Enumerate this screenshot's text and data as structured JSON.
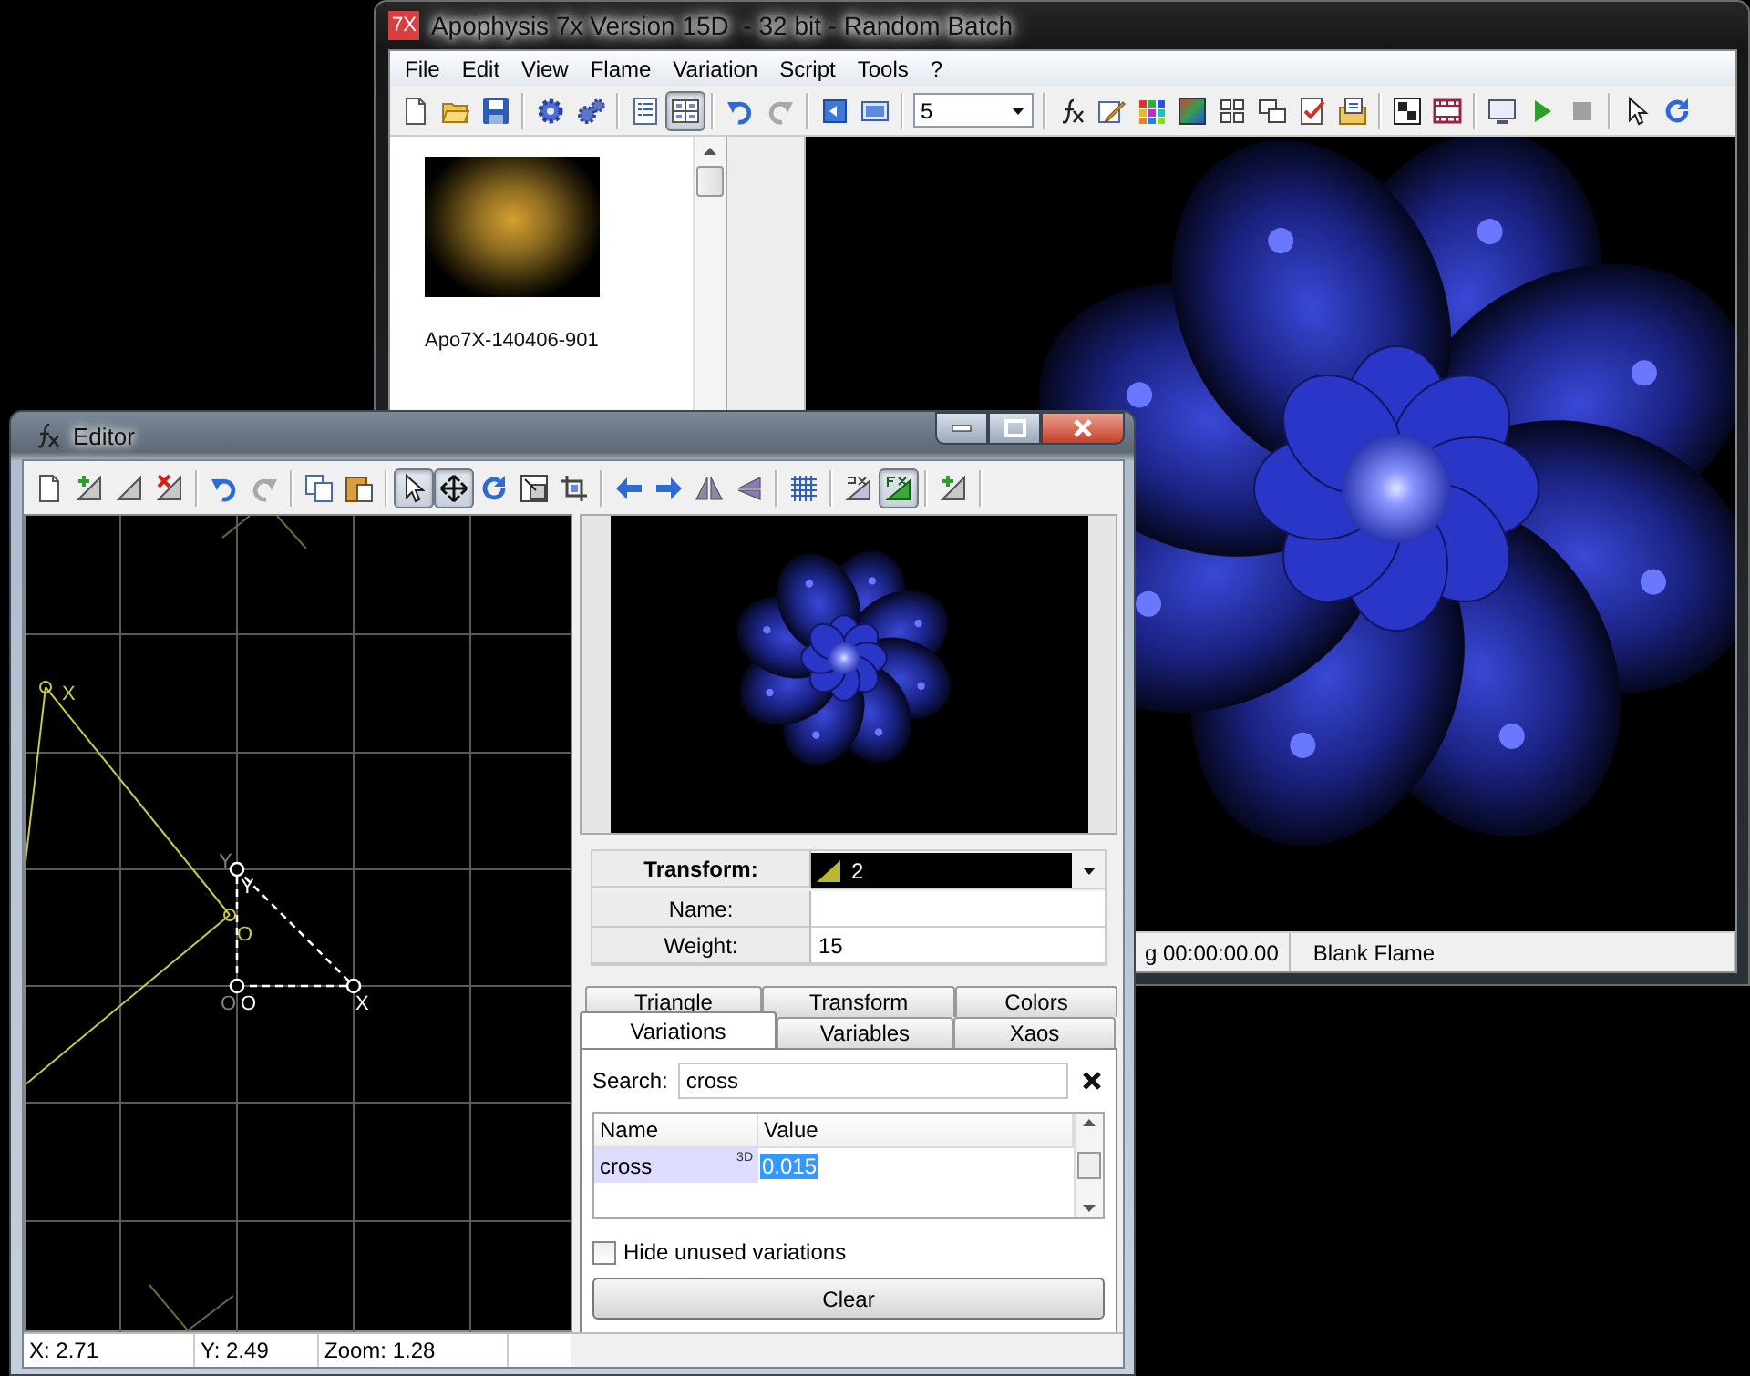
{
  "main_window": {
    "icon_text": "7X",
    "title": "Apophysis 7x Version 15D  - 32 bit - Random Batch",
    "menu": [
      "File",
      "Edit",
      "View",
      "Flame",
      "Variation",
      "Script",
      "Tools",
      "?"
    ],
    "toolbar": [
      {
        "kind": "new",
        "pressed": false
      },
      {
        "kind": "open",
        "pressed": false
      },
      {
        "kind": "save",
        "pressed": false
      },
      {
        "kind": "sep"
      },
      {
        "kind": "gear",
        "pressed": false
      },
      {
        "kind": "gears",
        "pressed": false
      },
      {
        "kind": "sep"
      },
      {
        "kind": "list",
        "pressed": false
      },
      {
        "kind": "tiles",
        "pressed": true
      },
      {
        "kind": "sep"
      },
      {
        "kind": "undo",
        "pressed": false
      },
      {
        "kind": "redo",
        "pressed": false
      },
      {
        "kind": "sep"
      },
      {
        "kind": "back",
        "pressed": false
      },
      {
        "kind": "screen",
        "pressed": false
      },
      {
        "kind": "sep"
      },
      {
        "kind": "combo",
        "value": "5"
      },
      {
        "kind": "sep"
      },
      {
        "kind": "fx",
        "pressed": false
      },
      {
        "kind": "edit",
        "pressed": false
      },
      {
        "kind": "palette",
        "pressed": false
      },
      {
        "kind": "gradient",
        "pressed": false
      },
      {
        "kind": "grid4",
        "pressed": false
      },
      {
        "kind": "windows",
        "pressed": false
      },
      {
        "kind": "checklist",
        "pressed": false
      },
      {
        "kind": "script",
        "pressed": false
      },
      {
        "kind": "sep"
      },
      {
        "kind": "checker",
        "pressed": false
      },
      {
        "kind": "film",
        "pressed": false
      },
      {
        "kind": "sep"
      },
      {
        "kind": "monitor",
        "pressed": false
      },
      {
        "kind": "play",
        "pressed": false
      },
      {
        "kind": "stop",
        "pressed": false
      },
      {
        "kind": "sep"
      },
      {
        "kind": "cursor",
        "pressed": false
      },
      {
        "kind": "refresh",
        "pressed": false
      }
    ],
    "thumbnails": [
      {
        "label": "Apo7X-140406-901"
      }
    ],
    "status_bar": [
      "g 00:00:00.00",
      "Blank Flame"
    ]
  },
  "editor": {
    "title": "Editor",
    "toolbar": [
      {
        "kind": "new",
        "pressed": false
      },
      {
        "kind": "addtri",
        "pressed": false
      },
      {
        "kind": "tri",
        "pressed": false
      },
      {
        "kind": "deltri",
        "pressed": false
      },
      {
        "kind": "sep"
      },
      {
        "kind": "undo",
        "pressed": false
      },
      {
        "kind": "redo",
        "pressed": false
      },
      {
        "kind": "sep"
      },
      {
        "kind": "copy",
        "pressed": false
      },
      {
        "kind": "paste",
        "pressed": false
      },
      {
        "kind": "sep"
      },
      {
        "kind": "cursor",
        "pressed": true
      },
      {
        "kind": "move",
        "pressed": true
      },
      {
        "kind": "rotate",
        "pressed": false
      },
      {
        "kind": "scale",
        "pressed": false
      },
      {
        "kind": "frame",
        "pressed": false
      },
      {
        "kind": "sep"
      },
      {
        "kind": "left",
        "pressed": false
      },
      {
        "kind": "right",
        "pressed": false
      },
      {
        "kind": "fliph",
        "pressed": false
      },
      {
        "kind": "flipv",
        "pressed": false
      },
      {
        "kind": "sep"
      },
      {
        "kind": "grid",
        "pressed": false
      },
      {
        "kind": "sep"
      },
      {
        "kind": "pxtri",
        "pressed": false
      },
      {
        "kind": "fxtri",
        "pressed": true
      },
      {
        "kind": "sep"
      },
      {
        "kind": "addtri",
        "pressed": false
      },
      {
        "kind": "sep"
      }
    ],
    "canvas": {
      "labels": [
        {
          "text": "X",
          "color": "#c8c84a"
        },
        {
          "text": "Y",
          "color": "#808080"
        },
        {
          "text": "Y",
          "color": "#ffffff"
        },
        {
          "text": "O",
          "color": "#c8c84a"
        },
        {
          "text": "O",
          "color": "#808080"
        },
        {
          "text": "O",
          "color": "#ffffff"
        },
        {
          "text": "X",
          "color": "#ffffff"
        }
      ]
    },
    "transform": {
      "label": "Transform:",
      "value": "2",
      "name_label": "Name:",
      "weight_label": "Weight:",
      "weight": "15"
    },
    "tabs": [
      {
        "label": "Triangle",
        "selected": false
      },
      {
        "label": "Transform",
        "selected": false
      },
      {
        "label": "Colors",
        "selected": false
      },
      {
        "label": "Variations",
        "selected": true
      },
      {
        "label": "Variables",
        "selected": false
      },
      {
        "label": "Xaos",
        "selected": false
      }
    ],
    "search": {
      "label": "Search:",
      "value": "cross"
    },
    "variations": {
      "columns": [
        "Name",
        "Value"
      ],
      "rows": [
        {
          "name": "cross",
          "tag": "3D",
          "value": "0.015",
          "selected": true
        }
      ]
    },
    "hide_unused": {
      "label": "Hide unused variations",
      "checked": false
    },
    "clear_button": "Clear",
    "status_bar": [
      "X: 2.71",
      "Y: 2.49",
      "Zoom: 1.28"
    ]
  }
}
